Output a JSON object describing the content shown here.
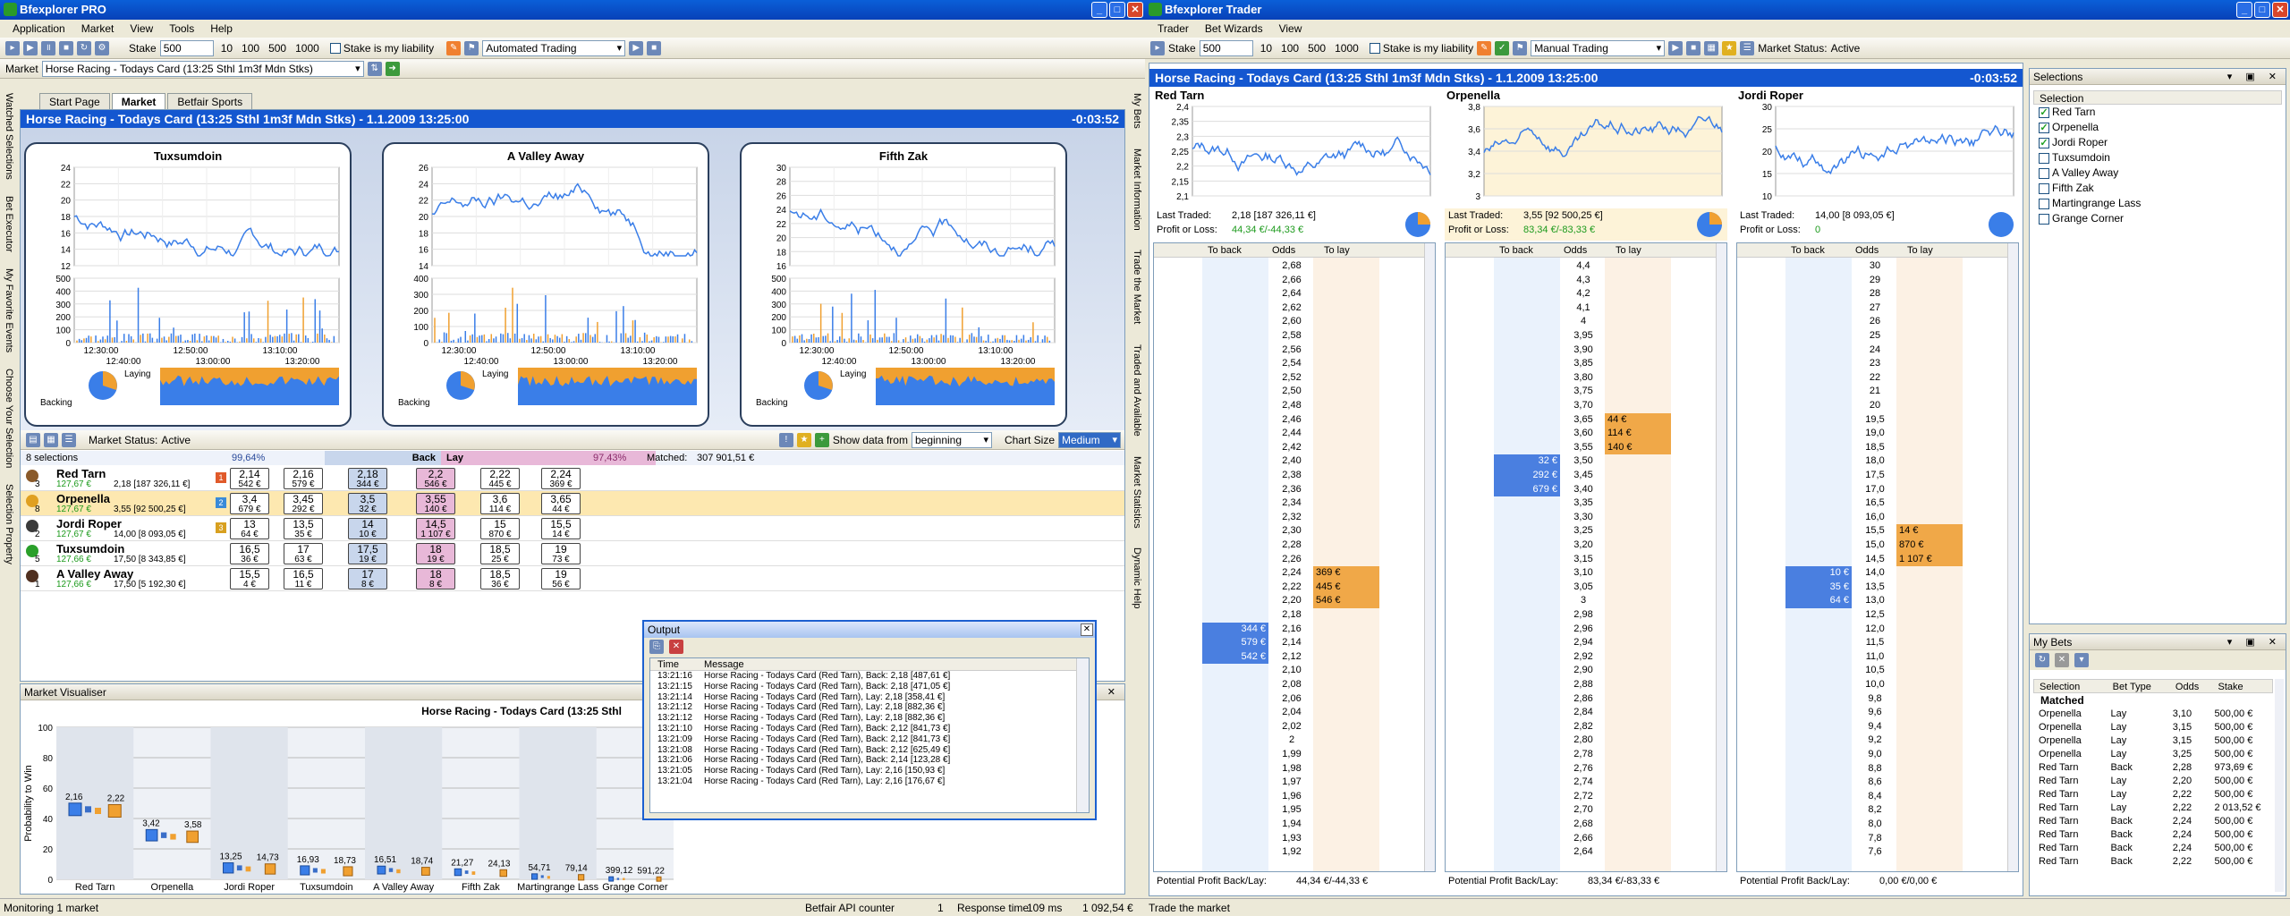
{
  "left_window": {
    "title": "Bfexplorer PRO",
    "menu": [
      "Application",
      "Market",
      "View",
      "Tools",
      "Help"
    ],
    "toolbar": {
      "stake_label": "Stake",
      "stake_value": "500",
      "stakes": [
        "10",
        "100",
        "500",
        "1000"
      ],
      "liability_label": "Stake is my liability",
      "mode": "Automated Trading"
    },
    "market_bar": {
      "label": "Market",
      "value": "Horse Racing - Todays Card (13:25 Sthl 1m3f Mdn Stks)"
    },
    "tabs": [
      "Start Page",
      "Market",
      "Betfair Sports"
    ],
    "active_tab": "Market",
    "left_vtabs": [
      "Watched Selections",
      "Bet Executor",
      "My Favorite Events",
      "Choose Your Selection",
      "Selection Property"
    ],
    "right_vtabs": [
      "My Bets",
      "Market Information",
      "Trade the Market",
      "Traded and Available",
      "Market Statistics",
      "Dynamic Help"
    ],
    "market_header": {
      "title": "Horse Racing - Todays Card (13:25 Sthl 1m3f Mdn Stks) - 1.1.2009 13:25:00",
      "countdown": "-0:03:52"
    },
    "charts": [
      {
        "name": "Tuxsumdoin",
        "price_ticks": [
          "24",
          "22",
          "20",
          "18",
          "16",
          "14",
          "12"
        ],
        "volume_ticks": [
          "500",
          "400",
          "300",
          "200",
          "100",
          "0"
        ],
        "time_ticks": [
          "12:30:00",
          "12:50:00",
          "13:10:00",
          "12:40:00",
          "13:00:00",
          "13:20:00"
        ],
        "laying": "Laying",
        "backing": "Backing"
      },
      {
        "name": "A Valley Away",
        "price_ticks": [
          "26",
          "24",
          "22",
          "20",
          "18",
          "16",
          "14"
        ],
        "volume_ticks": [
          "400",
          "300",
          "200",
          "100",
          "0"
        ],
        "time_ticks": [
          "12:30:00",
          "12:50:00",
          "13:10:00",
          "12:40:00",
          "13:00:00",
          "13:20:00"
        ],
        "laying": "Laying",
        "backing": "Backing"
      },
      {
        "name": "Fifth Zak",
        "price_ticks": [
          "30",
          "28",
          "26",
          "24",
          "22",
          "20",
          "18",
          "16"
        ],
        "volume_ticks": [
          "500",
          "400",
          "300",
          "200",
          "100",
          "0"
        ],
        "time_ticks": [
          "12:30:00",
          "12:50:00",
          "13:10:00",
          "12:40:00",
          "13:00:00",
          "13:20:00"
        ],
        "laying": "Laying",
        "backing": "Backing"
      }
    ],
    "market_status_bar": {
      "status_label": "Market Status:",
      "status": "Active",
      "show_data_label": "Show data from",
      "show_data_value": "beginning",
      "chart_size_label": "Chart Size",
      "chart_size_value": "Medium"
    },
    "grid_header": {
      "selections": "8 selections",
      "back_pct": "99,64%",
      "back": "Back",
      "lay": "Lay",
      "lay_pct": "97,43%",
      "matched_label": "Matched:",
      "matched": "307 901,51 €"
    },
    "runners": [
      {
        "num": "3",
        "name": "Red Tarn",
        "pl": "127,67 €",
        "last": "2,18 [187 326,11 €]",
        "badge": "1",
        "prices": [
          [
            "2,14",
            "542 €"
          ],
          [
            "2,16",
            "579 €"
          ],
          [
            "2,18",
            "344 €"
          ],
          [
            "2,2",
            "546 €"
          ],
          [
            "2,22",
            "445 €"
          ],
          [
            "2,24",
            "369 €"
          ]
        ]
      },
      {
        "num": "8",
        "name": "Orpenella",
        "pl": "127,67 €",
        "last": "3,55 [92 500,25 €]",
        "badge": "2",
        "prices": [
          [
            "3,4",
            "679 €"
          ],
          [
            "3,45",
            "292 €"
          ],
          [
            "3,5",
            "32 €"
          ],
          [
            "3,55",
            "140 €"
          ],
          [
            "3,6",
            "114 €"
          ],
          [
            "3,65",
            "44 €"
          ]
        ]
      },
      {
        "num": "2",
        "name": "Jordi Roper",
        "pl": "127,67 €",
        "last": "14,00 [8 093,05 €]",
        "badge": "3",
        "prices": [
          [
            "13",
            "64 €"
          ],
          [
            "13,5",
            "35 €"
          ],
          [
            "14",
            "10 €"
          ],
          [
            "14,5",
            "1 107 €"
          ],
          [
            "15",
            "870 €"
          ],
          [
            "15,5",
            "14 €"
          ]
        ]
      },
      {
        "num": "5",
        "name": "Tuxsumdoin",
        "pl": "127,66 €",
        "last": "17,50 [8 343,85 €]",
        "badge": "",
        "prices": [
          [
            "16,5",
            "36 €"
          ],
          [
            "17",
            "63 €"
          ],
          [
            "17,5",
            "19 €"
          ],
          [
            "18",
            "19 €"
          ],
          [
            "18,5",
            "25 €"
          ],
          [
            "19",
            "73 €"
          ]
        ]
      },
      {
        "num": "1",
        "name": "A Valley Away",
        "pl": "127,66 €",
        "last": "17,50 [5 192,30 €]",
        "badge": "",
        "prices": [
          [
            "15,5",
            "4 €"
          ],
          [
            "16,5",
            "11 €"
          ],
          [
            "17",
            "8 €"
          ],
          [
            "18",
            "8 €"
          ],
          [
            "18,5",
            "36 €"
          ],
          [
            "19",
            "56 €"
          ]
        ]
      }
    ],
    "output": {
      "title": "Output",
      "col_time": "Time",
      "col_message": "Message",
      "rows": [
        [
          "13:21:16",
          "Horse Racing - Todays Card (Red Tarn), Back: 2,18 [487,61 €]"
        ],
        [
          "13:21:15",
          "Horse Racing - Todays Card (Red Tarn), Back: 2,18 [471,05 €]"
        ],
        [
          "13:21:14",
          "Horse Racing - Todays Card (Red Tarn), Lay: 2,18 [358,41 €]"
        ],
        [
          "13:21:12",
          "Horse Racing - Todays Card (Red Tarn), Lay: 2,18 [882,36 €]"
        ],
        [
          "13:21:12",
          "Horse Racing - Todays Card (Red Tarn), Lay: 2,18 [882,36 €]"
        ],
        [
          "13:21:10",
          "Horse Racing - Todays Card (Red Tarn), Back: 2,12 [841,73 €]"
        ],
        [
          "13:21:09",
          "Horse Racing - Todays Card (Red Tarn), Back: 2,12 [841,73 €]"
        ],
        [
          "13:21:08",
          "Horse Racing - Todays Card (Red Tarn), Back: 2,12 [625,49 €]"
        ],
        [
          "13:21:06",
          "Horse Racing - Todays Card (Red Tarn), Back: 2,14 [123,28 €]"
        ],
        [
          "13:21:05",
          "Horse Racing - Todays Card (Red Tarn), Lay: 2,16 [150,93 €]"
        ],
        [
          "13:21:04",
          "Horse Racing - Todays Card (Red Tarn), Lay: 2,16 [176,67 €]"
        ]
      ]
    },
    "visualiser": {
      "panel_title": "Market Visualiser",
      "chart_title": "Horse Racing - Todays Card (13:25 Sthl",
      "ylabel": "Probability to Win"
    },
    "status_bar": {
      "left": "Monitoring 1 market",
      "api": "Betfair API counter",
      "api_val": "1",
      "resp_label": "Response time",
      "resp_val": "109 ms",
      "balance": "1 092,54 €"
    }
  },
  "chart_data": {
    "type": "scatter",
    "title": "Horse Racing - Todays Card (13:25 Sthl",
    "xlabel": "",
    "ylabel": "Probability to Win",
    "ylim": [
      0,
      100
    ],
    "yticks": [
      0,
      20,
      40,
      60,
      80,
      100
    ],
    "categories": [
      "Red Tarn",
      "Orpenella",
      "Jordi Roper",
      "Tuxsumdoin",
      "A Valley Away",
      "Fifth Zak",
      "Martingrange Lass",
      "Grange Corner"
    ],
    "labels": [
      [
        "2,16",
        "2,22"
      ],
      [
        "3,42",
        "3,58"
      ],
      [
        "13,25",
        "14,73"
      ],
      [
        "16,93",
        "18,73"
      ],
      [
        "16,51",
        "18,74"
      ],
      [
        "21,27",
        "24,13"
      ],
      [
        "54,71",
        "79,14"
      ],
      [
        "399,12",
        "591,22"
      ]
    ],
    "back_values": [
      46,
      29,
      7.5,
      5.9,
      6.1,
      4.7,
      1.8,
      0.25
    ],
    "lay_values": [
      45,
      28,
      6.8,
      5.3,
      5.3,
      4.1,
      1.3,
      0.17
    ]
  },
  "right_window": {
    "title": "Bfexplorer Trader",
    "menu": [
      "Trader",
      "Bet Wizards",
      "View"
    ],
    "toolbar": {
      "stake_label": "Stake",
      "stake_value": "500",
      "stakes": [
        "10",
        "100",
        "500",
        "1000"
      ],
      "liability_label": "Stake is my liability",
      "mode": "Manual Trading",
      "status_label": "Market Status:",
      "status": "Active"
    },
    "market_header": {
      "title": "Horse Racing - Todays Card (13:25 Sthl 1m3f Mdn Stks) - 1.1.2009 13:25:00",
      "countdown": "-0:03:52"
    },
    "traders": [
      {
        "name": "Red Tarn",
        "ticks": [
          "2,4",
          "2,35",
          "2,3",
          "2,25",
          "2,2",
          "2,15",
          "2,1"
        ],
        "last_label": "Last Traded:",
        "last": "2,18 [187 326,11 €]",
        "pl_label": "Profit or Loss:",
        "pl": "44,34 €/-44,33 €",
        "potential_label": "Potential Profit Back/Lay:",
        "potential": "44,34 €/-44,33 €",
        "ladder_header": [
          "To back",
          "Odds",
          "To lay"
        ],
        "odds": [
          "2,68",
          "2,66",
          "2,64",
          "2,62",
          "2,60",
          "2,58",
          "2,56",
          "2,54",
          "2,52",
          "2,50",
          "2,48",
          "2,46",
          "2,44",
          "2,42",
          "2,40",
          "2,38",
          "2,36",
          "2,34",
          "2,32",
          "2,30",
          "2,28",
          "2,26",
          "2,24",
          "2,22",
          "2,20",
          "2,18",
          "2,16",
          "2,14",
          "2,12",
          "2,10",
          "2,08",
          "2,06",
          "2,04",
          "2,02",
          "2",
          "1,99",
          "1,98",
          "1,97",
          "1,96",
          "1,95",
          "1,94",
          "1,93",
          "1,92"
        ],
        "back": {
          "26": "344 €",
          "27": "579 €",
          "28": "542 €"
        },
        "lay": {
          "22": "369 €",
          "23": "445 €",
          "24": "546 €"
        }
      },
      {
        "name": "Orpenella",
        "ticks": [
          "3,8",
          "3,6",
          "3,4",
          "3,2",
          "3"
        ],
        "last_label": "Last Traded:",
        "last": "3,55 [92 500,25 €]",
        "pl_label": "Profit or Loss:",
        "pl": "83,34 €/-83,33 €",
        "potential_label": "Potential Profit Back/Lay:",
        "potential": "83,34 €/-83,33 €",
        "ladder_header": [
          "To back",
          "Odds",
          "To lay"
        ],
        "odds": [
          "4,4",
          "4,3",
          "4,2",
          "4,1",
          "4",
          "3,95",
          "3,90",
          "3,85",
          "3,80",
          "3,75",
          "3,70",
          "3,65",
          "3,60",
          "3,55",
          "3,50",
          "3,45",
          "3,40",
          "3,35",
          "3,30",
          "3,25",
          "3,20",
          "3,15",
          "3,10",
          "3,05",
          "3",
          "2,98",
          "2,96",
          "2,94",
          "2,92",
          "2,90",
          "2,88",
          "2,86",
          "2,84",
          "2,82",
          "2,80",
          "2,78",
          "2,76",
          "2,74",
          "2,72",
          "2,70",
          "2,68",
          "2,66",
          "2,64"
        ],
        "back": {
          "14": "32 €",
          "15": "292 €",
          "16": "679 €"
        },
        "lay": {
          "11": "44 €",
          "12": "114 €",
          "13": "140 €"
        }
      },
      {
        "name": "Jordi Roper",
        "ticks": [
          "30",
          "25",
          "20",
          "15",
          "10"
        ],
        "last_label": "Last Traded:",
        "last": "14,00 [8 093,05 €]",
        "pl_label": "Profit or Loss:",
        "pl": "0",
        "potential_label": "Potential Profit Back/Lay:",
        "potential": "0,00 €/0,00 €",
        "ladder_header": [
          "To back",
          "Odds",
          "To lay"
        ],
        "odds": [
          "30",
          "29",
          "28",
          "27",
          "26",
          "25",
          "24",
          "23",
          "22",
          "21",
          "20",
          "19,5",
          "19,0",
          "18,5",
          "18,0",
          "17,5",
          "17,0",
          "16,5",
          "16,0",
          "15,5",
          "15,0",
          "14,5",
          "14,0",
          "13,5",
          "13,0",
          "12,5",
          "12,0",
          "11,5",
          "11,0",
          "10,5",
          "10,0",
          "9,8",
          "9,6",
          "9,4",
          "9,2",
          "9,0",
          "8,8",
          "8,6",
          "8,4",
          "8,2",
          "8,0",
          "7,8",
          "7,6"
        ],
        "back": {
          "22": "10 €",
          "23": "35 €",
          "24": "64 €"
        },
        "lay": {
          "19": "14 €",
          "20": "870 €",
          "21": "1 107 €"
        }
      }
    ],
    "selections_panel": {
      "title": "Selections",
      "header": "Selection",
      "items": [
        {
          "name": "Red Tarn",
          "checked": true
        },
        {
          "name": "Orpenella",
          "checked": true
        },
        {
          "name": "Jordi Roper",
          "checked": true
        },
        {
          "name": "Tuxsumdoin",
          "checked": false
        },
        {
          "name": "A Valley Away",
          "checked": false
        },
        {
          "name": "Fifth Zak",
          "checked": false
        },
        {
          "name": "Martingrange Lass",
          "checked": false
        },
        {
          "name": "Grange Corner",
          "checked": false
        }
      ]
    },
    "my_bets": {
      "title": "My Bets",
      "headers": [
        "Selection",
        "Bet Type",
        "Odds",
        "Stake"
      ],
      "group": "Matched",
      "rows": [
        [
          "Orpenella",
          "Lay",
          "3,10",
          "500,00 €"
        ],
        [
          "Orpenella",
          "Lay",
          "3,15",
          "500,00 €"
        ],
        [
          "Orpenella",
          "Lay",
          "3,15",
          "500,00 €"
        ],
        [
          "Orpenella",
          "Lay",
          "3,25",
          "500,00 €"
        ],
        [
          "Red Tarn",
          "Back",
          "2,28",
          "973,69 €"
        ],
        [
          "Red Tarn",
          "Lay",
          "2,20",
          "500,00 €"
        ],
        [
          "Red Tarn",
          "Lay",
          "2,22",
          "500,00 €"
        ],
        [
          "Red Tarn",
          "Lay",
          "2,22",
          "2 013,52 €"
        ],
        [
          "Red Tarn",
          "Back",
          "2,24",
          "500,00 €"
        ],
        [
          "Red Tarn",
          "Back",
          "2,24",
          "500,00 €"
        ],
        [
          "Red Tarn",
          "Back",
          "2,24",
          "500,00 €"
        ],
        [
          "Red Tarn",
          "Back",
          "2,22",
          "500,00 €"
        ]
      ]
    },
    "status_bar": "Trade the market"
  },
  "colors": {
    "title_blue": "#0a5fd8",
    "header_blue": "#1457d0",
    "back": "#c8d6ec",
    "lay": "#e8b8d8",
    "ladder_back": "#4a7fe0",
    "ladder_lay": "#f0a848",
    "series_blue": "#3a7ee8",
    "series_orange": "#f0a030"
  }
}
